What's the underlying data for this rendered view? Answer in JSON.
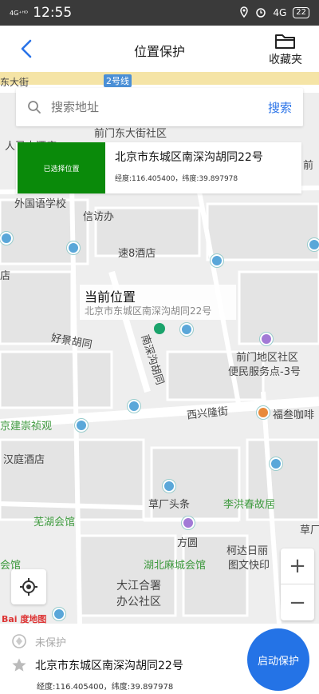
{
  "status": {
    "signal": "4G⁺ᴴᴰ",
    "time": "12:55",
    "net": "4G",
    "battery": "22"
  },
  "header": {
    "title": "位置保护",
    "favorites_label": "收藏夹"
  },
  "search": {
    "placeholder": "搜索地址",
    "button": "搜索"
  },
  "selected": {
    "badge": "已选择位置",
    "address": "北京市东城区南深沟胡同22号",
    "coords": "经度:116.405400，纬度:39.897978"
  },
  "current": {
    "title": "当前位置",
    "address": "北京市东城区南深沟胡同22号"
  },
  "map_labels": {
    "road_top": "东大街",
    "line2": "2号线",
    "qianmen": "前门东大街社区",
    "renmin": "人民大酒店",
    "foreign": "外国语学校",
    "xinfang": "信访办",
    "speed8": "速8酒店",
    "haojing": "好景胡同",
    "nanshen": "南深沟胡同",
    "qianmen_center1": "前门地区社区",
    "qianmen_center2": "便民服务点-3号",
    "xixinglong": "西兴隆街",
    "fushen": "福叁咖啡",
    "chongzhen": "京建崇祯观",
    "hanting": "汉庭酒店",
    "caochang": "草厂头条",
    "lihongchun": "李洪春故居",
    "wuhu": "芜湖会馆",
    "fangyuan": "方圆",
    "hubei": "湖北麻城会馆",
    "kedai1": "柯达日丽",
    "kedai2": "图文快印",
    "dajiang1": "大江合署",
    "dajiang2": "办公社区",
    "qian": "前",
    "caochang_r": "草厂",
    "hui": "会馆",
    "qian_right": "前",
    "dian": "店"
  },
  "map_controls": {
    "zoom_in": "+",
    "zoom_out": "−",
    "logo": "Bai 度地图"
  },
  "bottom": {
    "status": "未保护",
    "address": "北京市东城区南深沟胡同22号",
    "coords": "经度:116.405400，纬度:39.897978",
    "start_button": "启动保护"
  },
  "colors": {
    "accent": "#2473e6",
    "selected_badge": "#0a8a0a",
    "location_dot": "#1aa36b"
  }
}
